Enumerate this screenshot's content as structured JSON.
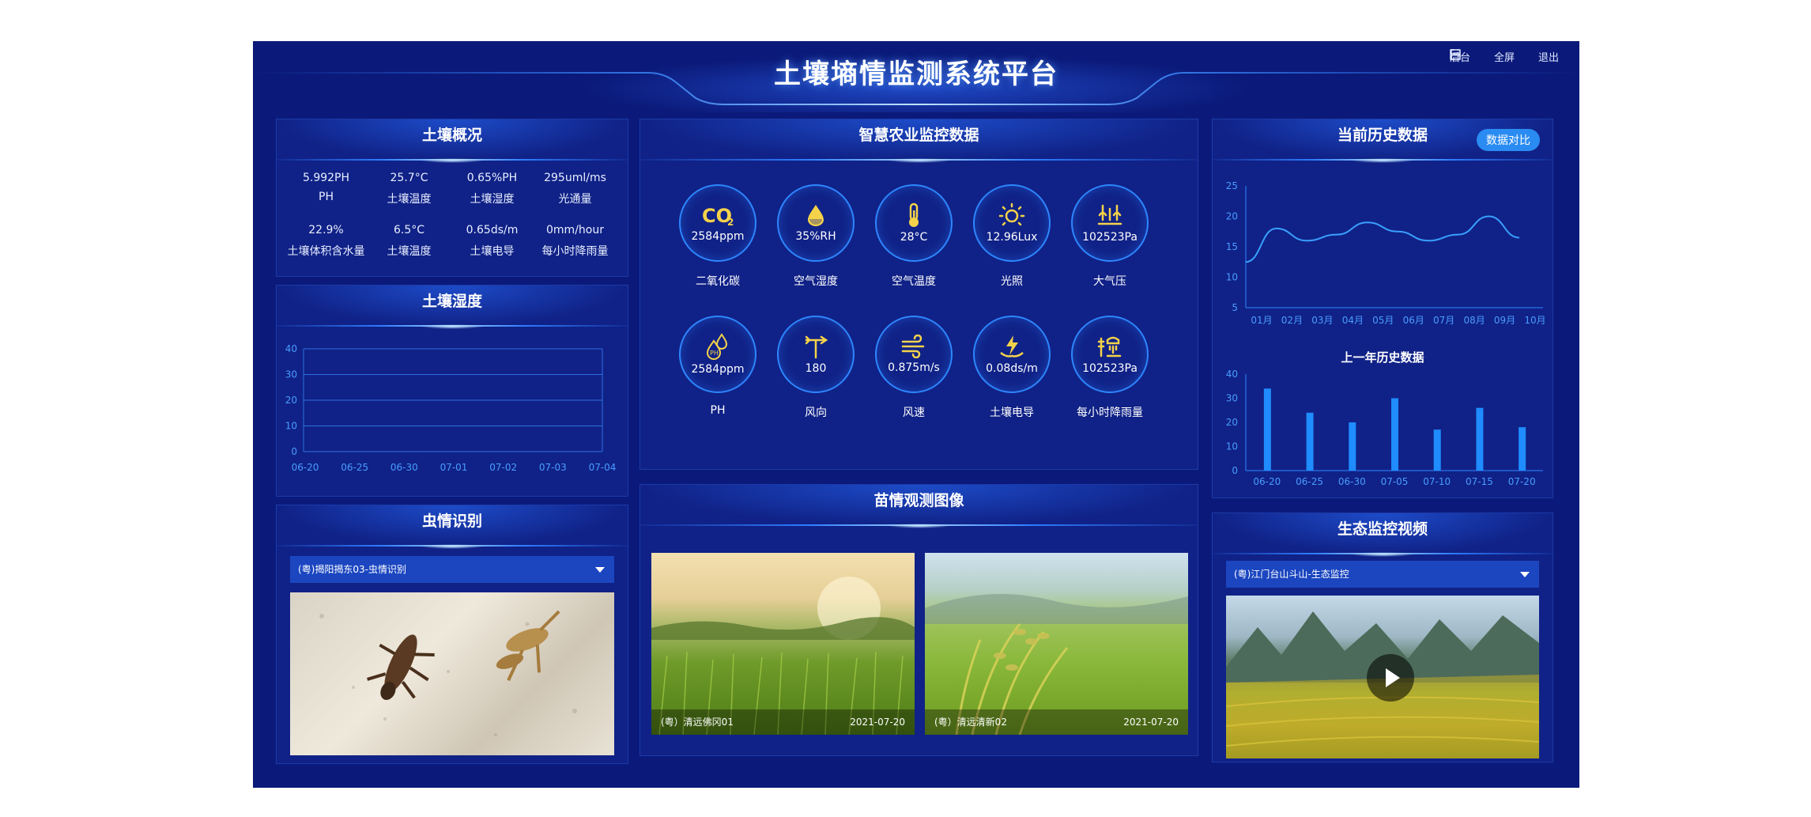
{
  "header": {
    "title": "土壤墒情监测系统平台",
    "nav": [
      {
        "label": "后台",
        "icon": "dashboard-icon"
      },
      {
        "label": "全屏",
        "icon": "fullscreen-icon"
      },
      {
        "label": "退出",
        "icon": "logout-icon"
      }
    ]
  },
  "soil_overview": {
    "title": "土壤概况",
    "items": [
      {
        "value": "5.992PH",
        "label": "PH"
      },
      {
        "value": "25.7°C",
        "label": "土壤温度"
      },
      {
        "value": "0.65%PH",
        "label": "土壤湿度"
      },
      {
        "value": "295uml/ms",
        "label": "光通量"
      },
      {
        "value": "22.9%",
        "label": "土壤体积含水量"
      },
      {
        "value": "6.5°C",
        "label": "土壤温度"
      },
      {
        "value": "0.65ds/m",
        "label": "土壤电导"
      },
      {
        "value": "0mm/hour",
        "label": "每小时降雨量"
      }
    ]
  },
  "soil_humidity": {
    "title": "土壤湿度",
    "chart_data": {
      "type": "bar",
      "categories": [
        "06-20",
        "06-25",
        "06-30",
        "07-01",
        "07-02",
        "07-03",
        "07-04"
      ],
      "values": [],
      "ylim": [
        0,
        40
      ],
      "yticks": [
        "0",
        "10",
        "20",
        "30",
        "40"
      ],
      "grid": true
    }
  },
  "pest": {
    "title": "虫情识别",
    "select_value": "(粤)揭阳揭东03-虫情识别"
  },
  "monitor": {
    "title": "智慧农业监控数据",
    "items": [
      {
        "icon": "co2-icon",
        "value": "2584ppm",
        "label": "二氧化碳"
      },
      {
        "icon": "droplet-icon",
        "value": "35%RH",
        "label": "空气湿度"
      },
      {
        "icon": "thermometer-icon",
        "value": "28°C",
        "label": "空气温度"
      },
      {
        "icon": "sun-icon",
        "value": "12.96Lux",
        "label": "光照"
      },
      {
        "icon": "pressure-icon",
        "value": "102523Pa",
        "label": "大气压"
      },
      {
        "icon": "ph-drops-icon",
        "value": "2584ppm",
        "label": "PH"
      },
      {
        "icon": "wind-vane-icon",
        "value": "180",
        "label": "风向"
      },
      {
        "icon": "wind-icon",
        "value": "0.875m/s",
        "label": "风速"
      },
      {
        "icon": "conductivity-icon",
        "value": "0.08ds/m",
        "label": "土壤电导"
      },
      {
        "icon": "rain-gauge-icon",
        "value": "102523Pa",
        "label": "每小时降雨量"
      }
    ]
  },
  "seedling": {
    "title": "苗情观测图像",
    "photos": [
      {
        "name": "(粤）清远佛冈01",
        "date": "2021-07-20"
      },
      {
        "name": "(粤）清远清新02",
        "date": "2021-07-20"
      }
    ]
  },
  "history": {
    "title": "当前历史数据",
    "compare_button": "数据对比",
    "subtitle_last_year": "上一年历史数据",
    "chart_data": [
      {
        "type": "line",
        "categories": [
          "01月",
          "02月",
          "03月",
          "04月",
          "05月",
          "06月",
          "07月",
          "08月",
          "09月",
          "10月"
        ],
        "values": [
          12.5,
          18,
          16,
          17,
          19,
          17.5,
          16,
          17,
          20,
          16.5
        ],
        "ylim": [
          5,
          25
        ],
        "yticks": [
          "5",
          "10",
          "15",
          "20",
          "25"
        ]
      },
      {
        "type": "bar",
        "categories": [
          "06-20",
          "06-25",
          "06-30",
          "07-05",
          "07-10",
          "07-15",
          "07-20"
        ],
        "values": [
          34,
          24,
          20,
          30,
          17,
          26,
          18
        ],
        "ylim": [
          0,
          40
        ],
        "yticks": [
          "0",
          "10",
          "20",
          "30",
          "40"
        ]
      }
    ]
  },
  "eco_video": {
    "title": "生态监控视频",
    "select_value": "(粤)江门台山斗山-生态监控"
  },
  "colors": {
    "background": "#0b1a7a",
    "panel": "#102287",
    "accent": "#2e86ff",
    "icon_yellow": "#f4d24a",
    "bar": "#1f8cff"
  }
}
